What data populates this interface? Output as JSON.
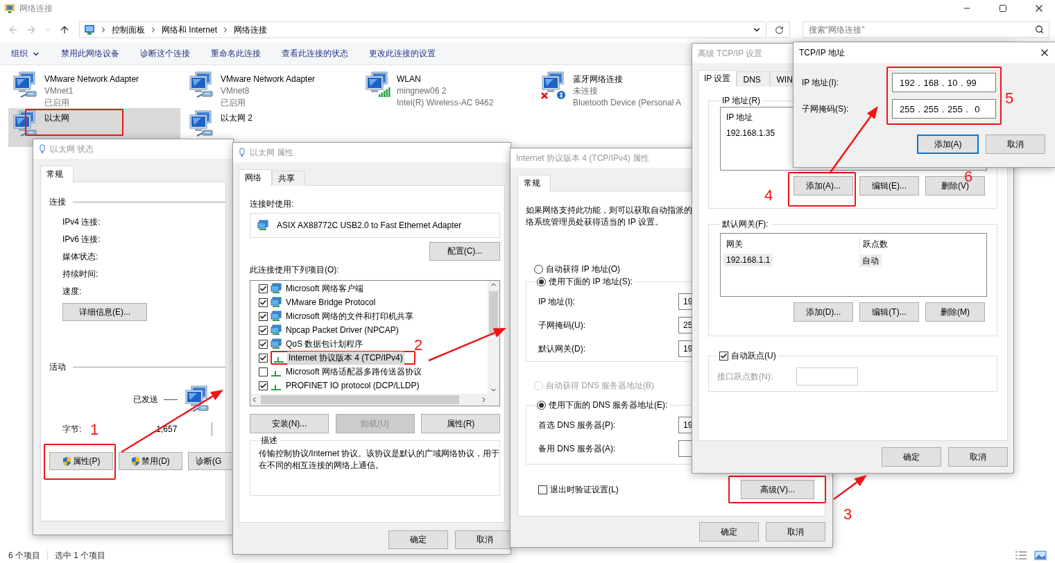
{
  "explorer": {
    "title": "网络连接",
    "breadcrumbs": [
      "控制面板",
      "网络和 Internet",
      "网络连接"
    ],
    "search": {
      "placeholder": "搜索\"网络连接\""
    },
    "toolbar": [
      {
        "label": "组织",
        "menu": true
      },
      {
        "label": "禁用此网络设备",
        "menu": false
      },
      {
        "label": "诊断这个连接",
        "menu": false
      },
      {
        "label": "重命名此连接",
        "menu": false
      },
      {
        "label": "查看此连接的状态",
        "menu": false
      },
      {
        "label": "更改此连接的设置",
        "menu": false
      }
    ],
    "connections": [
      {
        "name": "VMware Network Adapter",
        "lines": [
          "VMnet1",
          "已启用"
        ],
        "kind": "wired",
        "selected": false
      },
      {
        "name": "VMware Network Adapter",
        "lines": [
          "VMnet8",
          "已启用"
        ],
        "kind": "wired",
        "selected": false
      },
      {
        "name": "WLAN",
        "lines": [
          "mingnew06 2",
          "Intel(R) Wireless-AC 9462"
        ],
        "kind": "wifi",
        "selected": false
      },
      {
        "name": "蓝牙网络连接",
        "lines": [
          "未连接",
          "Bluetooth Device (Personal A"
        ],
        "kind": "bluetooth",
        "selected": false
      },
      {
        "name": "以太网",
        "kind": "wired",
        "selected": true
      },
      {
        "name": "以太网 2",
        "kind": "wired",
        "selected": false
      }
    ],
    "status_bar": {
      "count": "6 个项目",
      "selection": "选中 1 个项目"
    }
  },
  "status_dialog": {
    "title": "以太网 状态",
    "tabs": [
      {
        "label": "常规",
        "selected": true
      }
    ],
    "connection_group": "连接",
    "fields": [
      "IPv4 连接:",
      "IPv6 连接:",
      "媒体状态:",
      "持续时间:",
      "速度:"
    ],
    "details_button": "详细信息(E)...",
    "activity_group": "活动",
    "sent_label": "已发送",
    "bytes_label": "字节:",
    "bytes_sent": "1,657",
    "buttons": [
      {
        "label": "属性(P)",
        "shield": true
      },
      {
        "label": "禁用(D)",
        "shield": true
      },
      {
        "label": "诊断(G",
        "shield": false
      }
    ]
  },
  "properties_dialog": {
    "title": "以太网 属性",
    "tabs": [
      {
        "label": "网络",
        "selected": true
      },
      {
        "label": "共享",
        "selected": false
      }
    ],
    "connect_using_label": "连接时使用:",
    "adapter": "ASIX AX88772C USB2.0 to Fast Ethernet Adapter",
    "configure_button": "配置(C)...",
    "items_label": "此连接使用下列项目(O):",
    "items": [
      {
        "label": "Microsoft 网络客户端",
        "checked": true,
        "kind": "client",
        "selected": false
      },
      {
        "label": "VMware Bridge Protocol",
        "checked": true,
        "kind": "client",
        "selected": false
      },
      {
        "label": "Microsoft 网络的文件和打印机共享",
        "checked": true,
        "kind": "client",
        "selected": false
      },
      {
        "label": "Npcap Packet Driver (NPCAP)",
        "checked": true,
        "kind": "client",
        "selected": false
      },
      {
        "label": "QoS 数据包计划程序",
        "checked": true,
        "kind": "client",
        "selected": false
      },
      {
        "label": "Internet 协议版本 4 (TCP/IPv4)",
        "checked": true,
        "kind": "protocol",
        "selected": true
      },
      {
        "label": "Microsoft 网络适配器多路传送器协议",
        "checked": false,
        "kind": "protocol",
        "selected": false
      },
      {
        "label": "PROFINET IO protocol (DCP/LLDP)",
        "checked": true,
        "kind": "protocol",
        "selected": false
      }
    ],
    "buttons": [
      {
        "label": "安装(N)...",
        "disabled": false
      },
      {
        "label": "卸载(U)",
        "disabled": true
      },
      {
        "label": "属性(R)",
        "disabled": false
      }
    ],
    "description_group": "描述",
    "description": "传输控制协议/Internet 协议。该协议是默认的广域网络协议，用于在不同的相互连接的网络上通信。",
    "footer_buttons": [
      "确定",
      "取消"
    ]
  },
  "ipv4_dialog": {
    "title": "Internet 协议版本 4 (TCP/IPv4) 属性",
    "tabs": [
      {
        "label": "常规",
        "selected": true
      }
    ],
    "intro_lines": [
      "如果网络支持此功能，则可以获取自动指派的",
      "络系统管理员处获得适当的 IP 设置。"
    ],
    "ip_modes": [
      {
        "label": "自动获得 IP 地址(O)",
        "selected": false,
        "disabled": false
      },
      {
        "label": "使用下面的 IP 地址(S):",
        "selected": true,
        "disabled": false
      }
    ],
    "ip_fields": [
      {
        "label": "IP 地址(I):",
        "value": "19"
      },
      {
        "label": "子网掩码(U):",
        "value": "25"
      },
      {
        "label": "默认网关(D):",
        "value": "19"
      }
    ],
    "dns_modes": [
      {
        "label": "自动获得 DNS 服务器地址(B)",
        "selected": false,
        "disabled": true
      },
      {
        "label": "使用下面的 DNS 服务器地址(E):",
        "selected": true,
        "disabled": false
      }
    ],
    "dns_fields": [
      {
        "label": "首选 DNS 服务器(P):",
        "value": "19"
      },
      {
        "label": "备用 DNS 服务器(A):"
      }
    ],
    "validate": {
      "label": "退出时验证设置(L)",
      "checked": false
    },
    "advanced_button": "高级(V)...",
    "footer_buttons": [
      "确定",
      "取消"
    ]
  },
  "advanced_dialog": {
    "title": "高级 TCP/IP 设置",
    "tabs": [
      {
        "label": "IP 设置",
        "selected": true
      },
      {
        "label": "DNS",
        "selected": false
      },
      {
        "label": "WIN",
        "selected": false
      }
    ],
    "ip_group": "IP 地址(R)",
    "ip_column": "IP 地址",
    "ip_rows": [
      "192.168.1.35"
    ],
    "ip_buttons": [
      "添加(A)...",
      "编辑(E)...",
      "删除(V)"
    ],
    "gateway_group": "默认网关(F):",
    "gateway_columns": [
      "网关",
      "跃点数"
    ],
    "gateway_rows": [
      {
        "cells": [
          "192.168.1.1",
          "自动"
        ],
        "selected": true
      }
    ],
    "gateway_buttons": [
      "添加(D)...",
      "编辑(T)...",
      "删除(M)"
    ],
    "auto_metric": {
      "label": "自动跃点(U)",
      "checked": true
    },
    "interface_metric": {
      "label": "接口跃点数(N):",
      "disabled": true
    },
    "footer_buttons": [
      "确定",
      "取消"
    ]
  },
  "address_dialog": {
    "title": "TCP/IP 地址",
    "fields": [
      {
        "label": "IP 地址(I):",
        "value": "192 . 168 . 10 . 99"
      },
      {
        "label": "子网掩码(S):",
        "value": "255 . 255 . 255 .  0"
      }
    ],
    "buttons": [
      {
        "label": "添加(A)",
        "default": true
      },
      {
        "label": "取消",
        "default": false
      }
    ]
  },
  "step_numbers": [
    "1",
    "2",
    "3",
    "4",
    "5",
    "6"
  ]
}
